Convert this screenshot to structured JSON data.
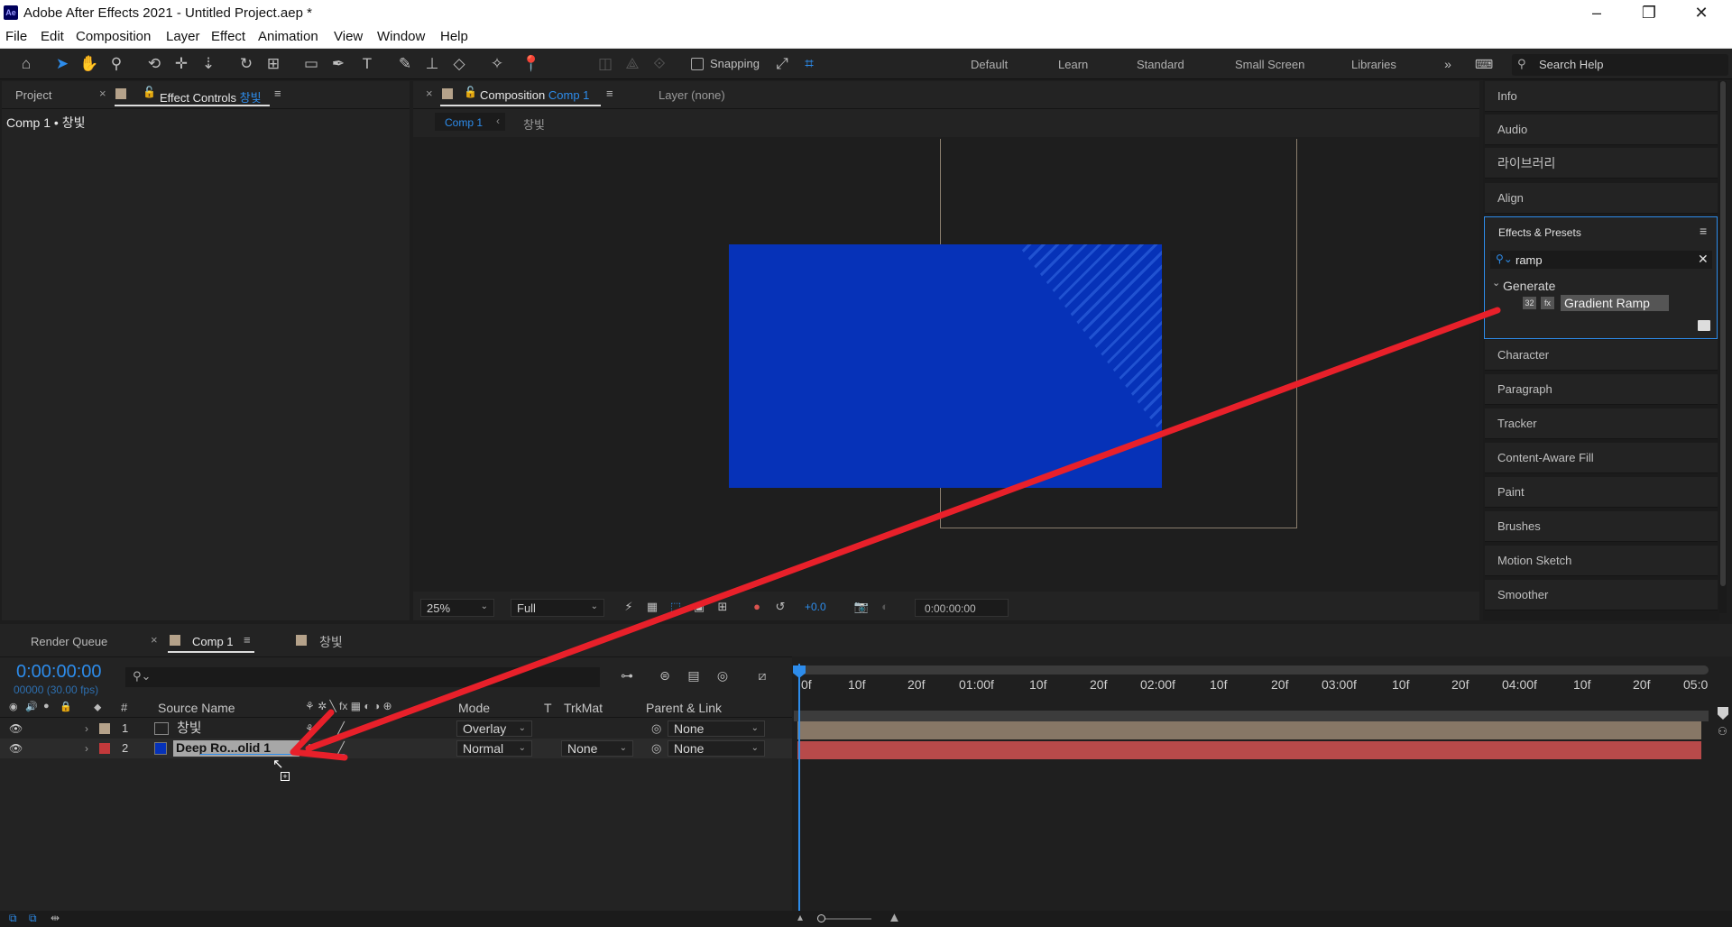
{
  "window": {
    "app_icon": "Ae",
    "title": "Adobe After Effects 2021 - Untitled Project.aep *"
  },
  "menu": [
    "File",
    "Edit",
    "Composition",
    "Layer",
    "Effect",
    "Animation",
    "View",
    "Window",
    "Help"
  ],
  "toolbar": {
    "snapping_label": "Snapping",
    "workspaces": [
      "Default",
      "Learn",
      "Standard",
      "Small Screen",
      "Libraries"
    ],
    "search_placeholder": "Search Help"
  },
  "left_panel": {
    "tab_project": "Project",
    "tab_effect_controls_prefix": "Effect Controls",
    "tab_effect_controls_layer": "창빛",
    "breadcrumb": "Comp 1 • 창빛"
  },
  "comp_panel": {
    "tab_prefix": "Composition",
    "tab_comp": "Comp 1",
    "layer_tab": "Layer (none)",
    "sub_tab_active": "Comp 1",
    "sub_tab_other": "창빛",
    "zoom": "25%",
    "resolution": "Full",
    "exposure": "+0.0",
    "timecode": "0:00:00:00"
  },
  "right_panel": {
    "top_items": [
      "Info",
      "Audio",
      "라이브러리",
      "Align"
    ],
    "effects_presets": {
      "title": "Effects & Presets",
      "search_value": "ramp",
      "category": "Generate",
      "effect": "Gradient Ramp",
      "effect_badge": "32"
    },
    "bottom_items": [
      "Character",
      "Paragraph",
      "Tracker",
      "Content-Aware Fill",
      "Paint",
      "Brushes",
      "Motion Sketch",
      "Smoother"
    ]
  },
  "timeline": {
    "tab_render_queue": "Render Queue",
    "tab_comp": "Comp 1",
    "tab_layer": "창빛",
    "timecode": "0:00:00:00",
    "fps": "00000 (30.00 fps)",
    "headers": {
      "num": "#",
      "source_name": "Source Name",
      "mode": "Mode",
      "t": "T",
      "trkmat": "TrkMat",
      "parent_link": "Parent & Link"
    },
    "layers": [
      {
        "num": "1",
        "name": "창빛",
        "mode": "Overlay",
        "trkmat": "",
        "parent": "None",
        "label_color": "#b5a28a"
      },
      {
        "num": "2",
        "name": "Deep Ro...olid 1",
        "mode": "Normal",
        "trkmat": "None",
        "parent": "None",
        "label_color": "#c3393b"
      }
    ],
    "ruler_labels": [
      "0f",
      "10f",
      "20f",
      "01:00f",
      "10f",
      "20f",
      "02:00f",
      "10f",
      "20f",
      "03:00f",
      "10f",
      "20f",
      "04:00f",
      "10f",
      "20f",
      "05:0"
    ]
  },
  "colors": {
    "accent": "#2d8ceb",
    "solid_blue": "#0632b8",
    "arrow": "#e8202a",
    "layer1_bar": "#877766",
    "layer2_bar": "#b84a4a"
  }
}
